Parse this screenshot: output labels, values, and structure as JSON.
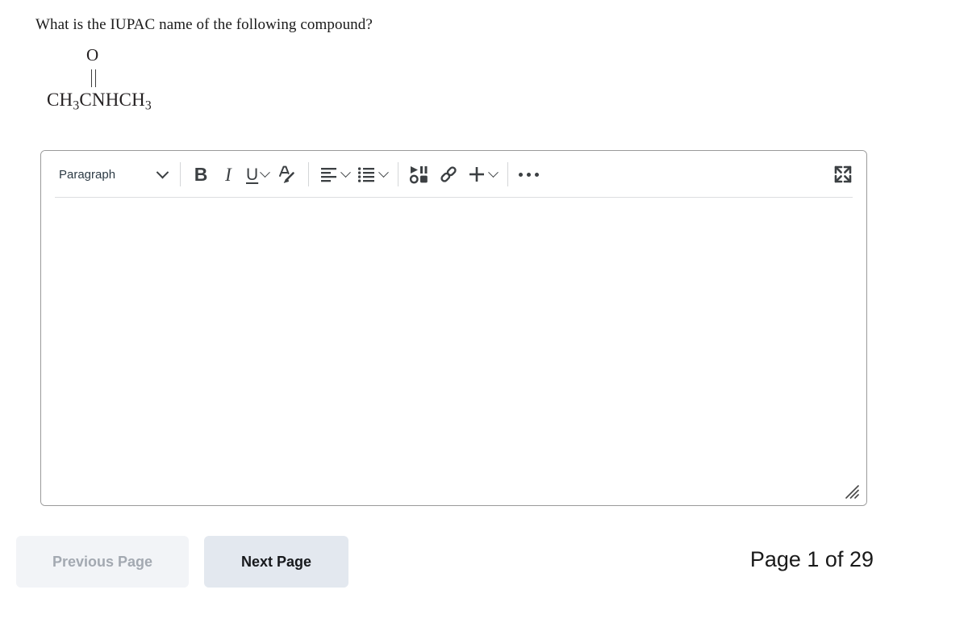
{
  "question": {
    "prompt": "What is the IUPAC name of the following compound?",
    "structure": {
      "oxygen_label": "O",
      "bond_type": "double-bond-vertical",
      "formula_parts": [
        {
          "text": "CH",
          "sub": "3"
        },
        {
          "text": "CNHCH",
          "sub": "3"
        }
      ],
      "formula_plain": "CH3CNHCH3"
    }
  },
  "editor": {
    "toolbar": {
      "block_format": {
        "label": "Paragraph",
        "icon": "chevron-down-icon"
      },
      "bold": {
        "label": "B",
        "icon": "bold-icon"
      },
      "italic": {
        "label": "I",
        "icon": "italic-icon"
      },
      "underline": {
        "label": "U",
        "icon": "underline-icon"
      },
      "text_color": {
        "icon": "text-color-brush-icon"
      },
      "align": {
        "icon": "align-left-icon"
      },
      "list": {
        "icon": "bulleted-list-icon"
      },
      "media": {
        "icon": "media-record-icon"
      },
      "link": {
        "icon": "link-chain-icon"
      },
      "insert": {
        "label": "+",
        "icon": "plus-icon"
      },
      "more": {
        "icon": "ellipsis-icon"
      },
      "fullscreen": {
        "icon": "expand-arrows-icon"
      }
    },
    "content": "",
    "placeholder": "",
    "resize_handle_icon": "resize-grip-icon"
  },
  "footer": {
    "previous_page_label": "Previous Page",
    "previous_page_disabled": true,
    "next_page_label": "Next Page",
    "page_indicator": "Page 1 of 29",
    "current_page": 1,
    "total_pages": 29
  },
  "colors": {
    "page_background": "#ffffff",
    "editor_border": "#9a9a9a",
    "toolbar_divider": "#dcdee0",
    "icon": "#3c4043",
    "prev_button_bg": "#f2f4f7",
    "prev_button_text": "#a3a9b1",
    "next_button_bg": "#e3e8ef",
    "next_button_text": "#17191c",
    "text": "#1a1a1a"
  }
}
